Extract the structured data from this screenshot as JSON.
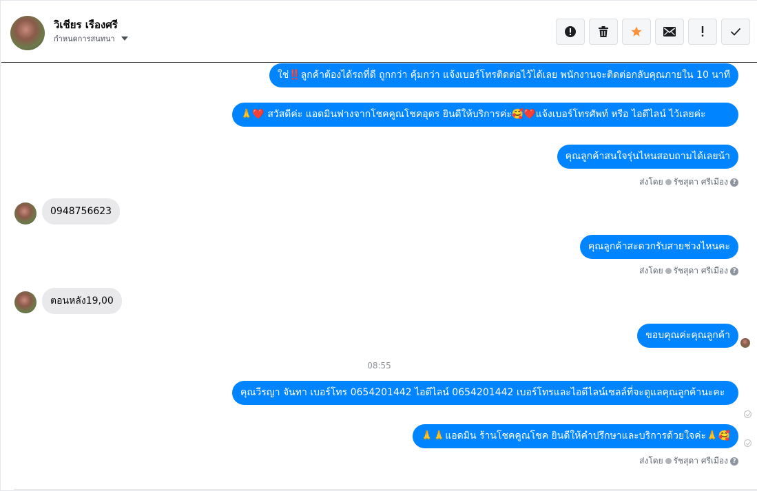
{
  "header": {
    "contact_name": "วิเชียร เรืองศรี",
    "assign_label": "กำหนดการสนทนา",
    "toolbar": [
      {
        "icon": "alert-icon",
        "name": "spam-button"
      },
      {
        "icon": "trash-icon",
        "name": "delete-button"
      },
      {
        "icon": "star-icon",
        "name": "star-button"
      },
      {
        "icon": "mail-icon",
        "name": "mark-unread-button"
      },
      {
        "icon": "exclamation-icon",
        "name": "follow-up-button"
      },
      {
        "icon": "check-icon",
        "name": "done-button"
      }
    ],
    "star_color": "#f7923a"
  },
  "messages": {
    "m1": "ใช่‼️ลูกค้าต้องได้รถที่ดี ถูกกว่า คุ้มกว่า แจ้งเบอร์โทรติดต่อไว้ได้เลย พนักงานจะติดต่อกลับคุณภายใน 10 นาที",
    "m2": "🙏❤️ สวัสดีค่ะ แอดมินฟางจากโชคคูณโชคอุดร ยินดีให้บริการค่ะ🥰❤️แจ้งเบอร์โทรศัพท์ หรือ ไอดีไลน์  ไว้เลยค่ะ",
    "m3": "คุณลูกค้าสนใจรุ่นไหนสอบถามได้เลยน้า",
    "sent1_prefix": "ส่งโดย",
    "sent1_name": "รัชสุดา ศรีเมือง",
    "in1": "0948756623",
    "m4": "คุณลูกค้าสะดวกรับสายช่วงไหนคะ",
    "sent2_prefix": "ส่งโดย",
    "sent2_name": "รัชสุดา ศรีเมือง",
    "in2": "ตอนหลัง19,00",
    "m5": "ขอบคุณค่ะคุณลูกค้า",
    "time": "08:55",
    "m6": "คุณวีรญา จันทา       เบอร์โทร 0654201442  ไอดีไลน์ 0654201442   เบอร์โทรและไอดีไลน์เซลล์ที่จะดูแลคุณลูกค้านะคะ",
    "m7": "🙏🙏แอดมิน ร้านโชคคูณโชค ยินดีให้คำปรึกษาและบริการด้วยใจค่ะ🙏🥰",
    "sent3_prefix": "ส่งโดย",
    "sent3_name": "รัชสุดา ศรีเมือง"
  },
  "colors": {
    "outgoing_bubble": "#0084ff",
    "incoming_bubble": "#e9e9eb"
  }
}
